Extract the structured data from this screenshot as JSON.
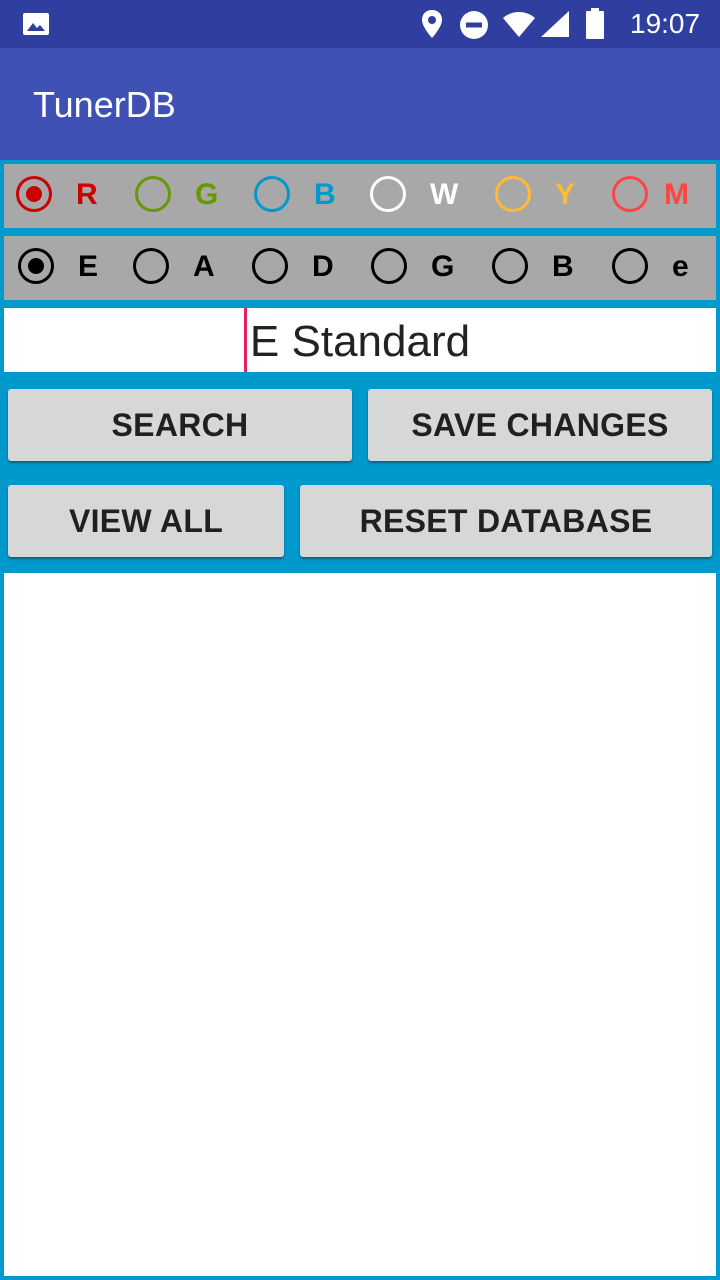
{
  "status_bar": {
    "time": "19:07",
    "icons": [
      "image-icon",
      "location-icon",
      "do-not-disturb-icon",
      "wifi-icon",
      "signal-icon",
      "battery-icon"
    ]
  },
  "app_bar": {
    "title": "TunerDB"
  },
  "color_options": [
    {
      "label": "R",
      "color": "#cc0000",
      "selected": true
    },
    {
      "label": "G",
      "color": "#669900",
      "selected": false
    },
    {
      "label": "B",
      "color": "#0099cc",
      "selected": false
    },
    {
      "label": "W",
      "color": "#ffffff",
      "selected": false
    },
    {
      "label": "Y",
      "color": "#ffbb33",
      "selected": false
    },
    {
      "label": "M",
      "color": "#ff4444",
      "selected": false
    }
  ],
  "string_options": [
    {
      "label": "E",
      "selected": true
    },
    {
      "label": "A",
      "selected": false
    },
    {
      "label": "D",
      "selected": false
    },
    {
      "label": "G",
      "selected": false
    },
    {
      "label": "B",
      "selected": false
    },
    {
      "label": "e",
      "selected": false
    }
  ],
  "tuning_input": {
    "value": "E Standard"
  },
  "buttons": {
    "search": "SEARCH",
    "save_changes": "SAVE CHANGES",
    "view_all": "VIEW ALL",
    "reset_database": "RESET DATABASE"
  },
  "colors": {
    "status_bar": "#303f9f",
    "app_bar": "#3f51b5",
    "background": "#0099cc",
    "radio_panel": "#a8a8a8",
    "cursor": "#e91e63"
  }
}
